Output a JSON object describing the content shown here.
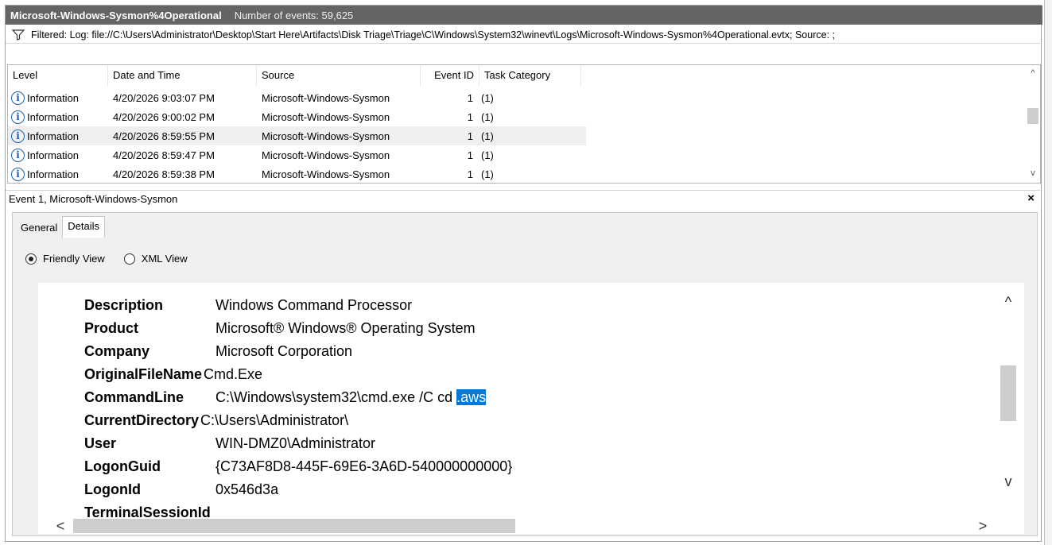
{
  "title_bar": {
    "log_name": "Microsoft-Windows-Sysmon%4Operational",
    "event_count": "Number of events: 59,625"
  },
  "filter": {
    "icon": "funnel-icon",
    "text": "Filtered: Log: file://C:\\Users\\Administrator\\Desktop\\Start Here\\Artifacts\\Disk Triage\\Triage\\C\\Windows\\System32\\winevt\\Logs\\Microsoft-Windows-Sysmon%4Operational.evtx; Source: ;"
  },
  "event_list": {
    "columns": [
      "Level",
      "Date and Time",
      "Source",
      "Event ID",
      "Task Category"
    ],
    "rows": [
      {
        "level": "Information",
        "date": "4/20/2026 9:03:07 PM",
        "source": "Microsoft-Windows-Sysmon",
        "event_id": "1",
        "task": "(1)"
      },
      {
        "level": "Information",
        "date": "4/20/2026 9:00:02 PM",
        "source": "Microsoft-Windows-Sysmon",
        "event_id": "1",
        "task": "(1)"
      },
      {
        "level": "Information",
        "date": "4/20/2026 8:59:55 PM",
        "source": "Microsoft-Windows-Sysmon",
        "event_id": "1",
        "task": "(1)"
      },
      {
        "level": "Information",
        "date": "4/20/2026 8:59:47 PM",
        "source": "Microsoft-Windows-Sysmon",
        "event_id": "1",
        "task": "(1)"
      },
      {
        "level": "Information",
        "date": "4/20/2026 8:59:38 PM",
        "source": "Microsoft-Windows-Sysmon",
        "event_id": "1",
        "task": "(1)"
      }
    ],
    "info_icon_glyph": "i",
    "scroll_up_glyph": "^",
    "scroll_down_glyph": "v"
  },
  "detail": {
    "header": "Event 1, Microsoft-Windows-Sysmon",
    "close_glyph": "×",
    "tabs": [
      "General",
      "Details"
    ],
    "active_tab": "Details",
    "view_options": [
      "Friendly View",
      "XML View"
    ],
    "selected_view": "Friendly View",
    "properties": [
      {
        "name": "Description",
        "value": "Windows Command Processor"
      },
      {
        "name": "Product",
        "value": "Microsoft® Windows® Operating System"
      },
      {
        "name": "Company",
        "value": "Microsoft Corporation"
      },
      {
        "name": "OriginalFileName",
        "value": "Cmd.Exe"
      },
      {
        "name": "CommandLine",
        "value": "C:\\Windows\\system32\\cmd.exe /C cd ",
        "highlight": ".aws"
      },
      {
        "name": "CurrentDirectory",
        "value": "C:\\Users\\Administrator\\"
      },
      {
        "name": "User",
        "value": "WIN-DMZ0\\Administrator"
      },
      {
        "name": "LogonGuid",
        "value": "{C73AF8D8-445F-69E6-3A6D-540000000000}"
      },
      {
        "name": "LogonId",
        "value": "0x546d3a"
      }
    ],
    "partial_bottom_row": "TerminalSessionId",
    "scroll_up_glyph": "^",
    "scroll_down_glyph": "v",
    "scroll_left_glyph": "<",
    "scroll_right_glyph": ">"
  }
}
